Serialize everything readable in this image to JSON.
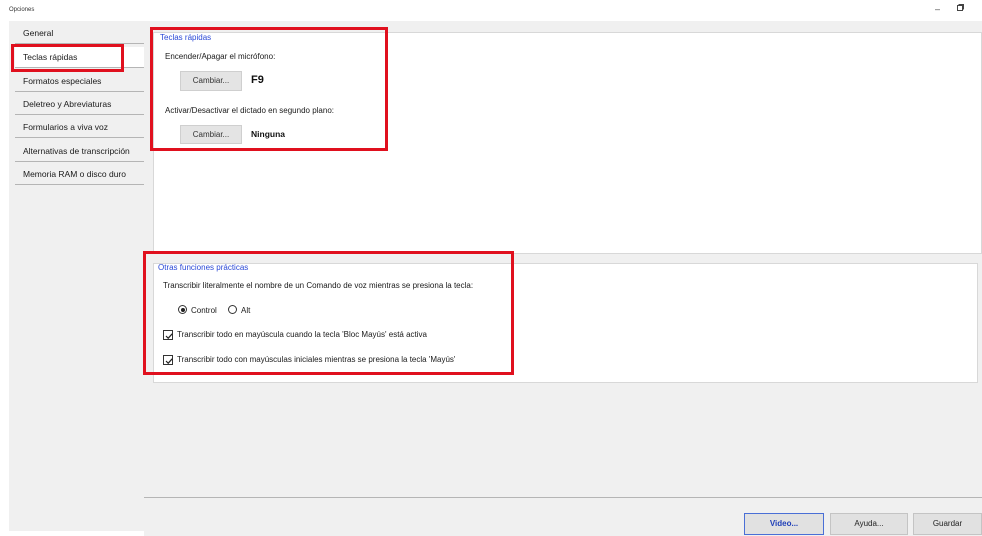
{
  "window": {
    "title": "Opciones",
    "minimize_icon": "minimize-icon",
    "restore_icon": "restore-icon"
  },
  "sidebar": {
    "items": [
      {
        "label": "General"
      },
      {
        "label": "Teclas rápidas"
      },
      {
        "label": "Formatos especiales"
      },
      {
        "label": "Deletreo y Abreviaturas"
      },
      {
        "label": "Formularios a viva voz"
      },
      {
        "label": "Alternativas de transcripción"
      },
      {
        "label": "Memoria RAM o disco duro"
      }
    ],
    "selected": "Teclas rápidas"
  },
  "hotkeys": {
    "title": "Teclas rápidas",
    "mic_label": "Encender/Apagar el micrófono:",
    "mic_button": "Cambiar...",
    "mic_key": "F9",
    "background_label": "Activar/Desactivar el dictado en segundo plano:",
    "background_button": "Cambiar...",
    "background_key": "Ninguna"
  },
  "other": {
    "title": "Otras funciones prácticas",
    "transcribe_label": "Transcribir literalmente el nombre de un Comando de voz mientras se presiona la tecla:",
    "radio_control": "Control",
    "radio_alt": "Alt",
    "selected_radio": "Control",
    "caps_lock_label": "Transcribir todo en mayúscula cuando la tecla 'Bloc Mayús' está activa",
    "caps_lock_checked": true,
    "shift_label": "Transcribir todo con mayúsculas iniciales mientras se presiona la tecla 'Mayús'",
    "shift_checked": true
  },
  "footer": {
    "video": "Video...",
    "help": "Ayuda...",
    "save": "Guardar"
  },
  "colors": {
    "highlight": "#e0101e",
    "group_title": "#2a48d6"
  }
}
